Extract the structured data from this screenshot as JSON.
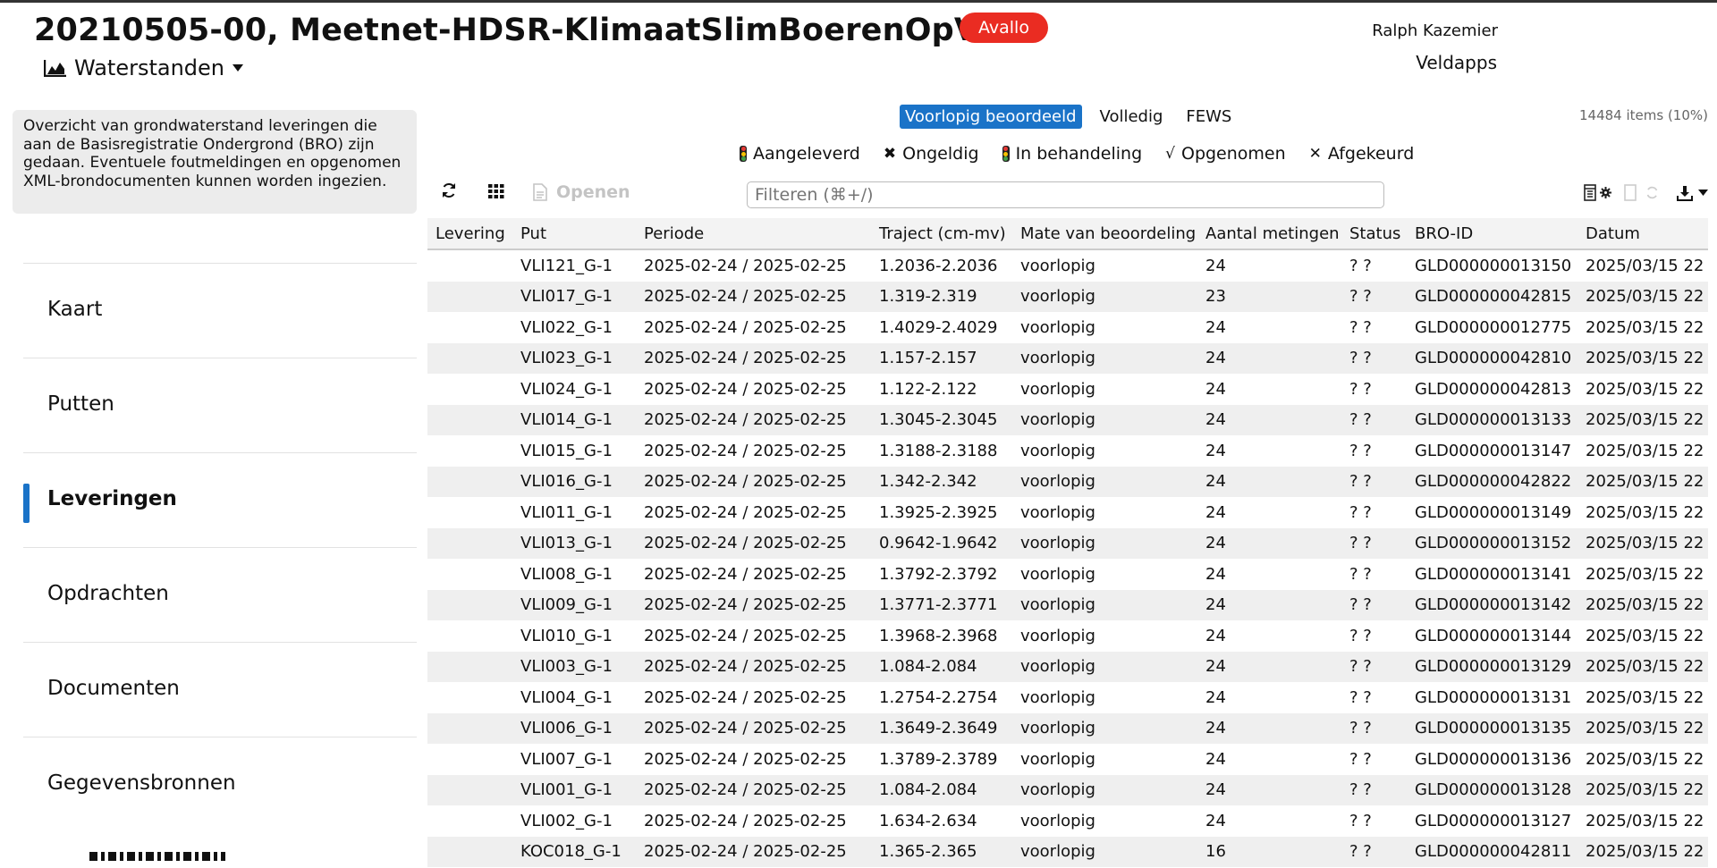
{
  "header": {
    "title": "20210505-00, Meetnet-HDSR-KlimaatSlimBoerenOpVeen",
    "badge": "Avallo",
    "view_label": "Waterstanden",
    "user": "Ralph Kazemier",
    "app_link": "Veldapps"
  },
  "sidebar": {
    "info": "Overzicht van grondwaterstand leveringen die aan de Basisregistratie Ondergrond (BRO) zijn gedaan. Eventuele foutmeldingen en opgenomen XML-brondocumenten kunnen worden ingezien.",
    "items": [
      {
        "label": "Kaart"
      },
      {
        "label": "Putten"
      },
      {
        "label": "Leveringen"
      },
      {
        "label": "Opdrachten"
      },
      {
        "label": "Documenten"
      },
      {
        "label": "Gegevensbronnen"
      }
    ]
  },
  "main": {
    "tabs": [
      {
        "label": "Voorlopig beoordeeld"
      },
      {
        "label": "Volledig"
      },
      {
        "label": "FEWS"
      }
    ],
    "item_count": "14484 items (10%)",
    "filters": [
      {
        "label": "Aangeleverd"
      },
      {
        "label": "Ongeldig"
      },
      {
        "label": "In behandeling"
      },
      {
        "label": "Opgenomen"
      },
      {
        "label": "Afgekeurd"
      }
    ],
    "open_label": "Openen",
    "search_placeholder": "Filteren (⌘+/)"
  },
  "colors": {
    "accent": "#1a73c8",
    "badge": "#ea2c22",
    "traffic_red": "#e53935",
    "traffic_yellow": "#f6c200",
    "traffic_green": "#43a047"
  },
  "icons": {
    "view": "area-chart-icon",
    "refresh": "refresh-icon",
    "grid": "grid-icon",
    "open": "document-icon",
    "export": "download-icon"
  },
  "table": {
    "columns": [
      "Levering",
      "Put",
      "Periode",
      "Traject (cm-mv)",
      "Mate van beoordeling",
      "Aantal metingen",
      "Status",
      "BRO-ID",
      "Datum"
    ],
    "rows": [
      [
        "",
        "VLI121_G-1",
        "2025-02-24 / 2025-02-25",
        "1.2036-2.2036",
        "voorlopig",
        "24",
        "? ?",
        "GLD000000013150",
        "2025/03/15 22"
      ],
      [
        "",
        "VLI017_G-1",
        "2025-02-24 / 2025-02-25",
        "1.319-2.319",
        "voorlopig",
        "23",
        "? ?",
        "GLD000000042815",
        "2025/03/15 22"
      ],
      [
        "",
        "VLI022_G-1",
        "2025-02-24 / 2025-02-25",
        "1.4029-2.4029",
        "voorlopig",
        "24",
        "? ?",
        "GLD000000012775",
        "2025/03/15 22"
      ],
      [
        "",
        "VLI023_G-1",
        "2025-02-24 / 2025-02-25",
        "1.157-2.157",
        "voorlopig",
        "24",
        "? ?",
        "GLD000000042810",
        "2025/03/15 22"
      ],
      [
        "",
        "VLI024_G-1",
        "2025-02-24 / 2025-02-25",
        "1.122-2.122",
        "voorlopig",
        "24",
        "? ?",
        "GLD000000042813",
        "2025/03/15 22"
      ],
      [
        "",
        "VLI014_G-1",
        "2025-02-24 / 2025-02-25",
        "1.3045-2.3045",
        "voorlopig",
        "24",
        "? ?",
        "GLD000000013133",
        "2025/03/15 22"
      ],
      [
        "",
        "VLI015_G-1",
        "2025-02-24 / 2025-02-25",
        "1.3188-2.3188",
        "voorlopig",
        "24",
        "? ?",
        "GLD000000013147",
        "2025/03/15 22"
      ],
      [
        "",
        "VLI016_G-1",
        "2025-02-24 / 2025-02-25",
        "1.342-2.342",
        "voorlopig",
        "24",
        "? ?",
        "GLD000000042822",
        "2025/03/15 22"
      ],
      [
        "",
        "VLI011_G-1",
        "2025-02-24 / 2025-02-25",
        "1.3925-2.3925",
        "voorlopig",
        "24",
        "? ?",
        "GLD000000013149",
        "2025/03/15 22"
      ],
      [
        "",
        "VLI013_G-1",
        "2025-02-24 / 2025-02-25",
        "0.9642-1.9642",
        "voorlopig",
        "24",
        "? ?",
        "GLD000000013152",
        "2025/03/15 22"
      ],
      [
        "",
        "VLI008_G-1",
        "2025-02-24 / 2025-02-25",
        "1.3792-2.3792",
        "voorlopig",
        "24",
        "? ?",
        "GLD000000013141",
        "2025/03/15 22"
      ],
      [
        "",
        "VLI009_G-1",
        "2025-02-24 / 2025-02-25",
        "1.3771-2.3771",
        "voorlopig",
        "24",
        "? ?",
        "GLD000000013142",
        "2025/03/15 22"
      ],
      [
        "",
        "VLI010_G-1",
        "2025-02-24 / 2025-02-25",
        "1.3968-2.3968",
        "voorlopig",
        "24",
        "? ?",
        "GLD000000013144",
        "2025/03/15 22"
      ],
      [
        "",
        "VLI003_G-1",
        "2025-02-24 / 2025-02-25",
        "1.084-2.084",
        "voorlopig",
        "24",
        "? ?",
        "GLD000000013129",
        "2025/03/15 22"
      ],
      [
        "",
        "VLI004_G-1",
        "2025-02-24 / 2025-02-25",
        "1.2754-2.2754",
        "voorlopig",
        "24",
        "? ?",
        "GLD000000013131",
        "2025/03/15 22"
      ],
      [
        "",
        "VLI006_G-1",
        "2025-02-24 / 2025-02-25",
        "1.3649-2.3649",
        "voorlopig",
        "24",
        "? ?",
        "GLD000000013135",
        "2025/03/15 22"
      ],
      [
        "",
        "VLI007_G-1",
        "2025-02-24 / 2025-02-25",
        "1.3789-2.3789",
        "voorlopig",
        "24",
        "? ?",
        "GLD000000013136",
        "2025/03/15 22"
      ],
      [
        "",
        "VLI001_G-1",
        "2025-02-24 / 2025-02-25",
        "1.084-2.084",
        "voorlopig",
        "24",
        "? ?",
        "GLD000000013128",
        "2025/03/15 22"
      ],
      [
        "",
        "VLI002_G-1",
        "2025-02-24 / 2025-02-25",
        "1.634-2.634",
        "voorlopig",
        "24",
        "? ?",
        "GLD000000013127",
        "2025/03/15 22"
      ],
      [
        "",
        "KOC018_G-1",
        "2025-02-24 / 2025-02-25",
        "1.365-2.365",
        "voorlopig",
        "16",
        "? ?",
        "GLD000000042811",
        "2025/03/15 22"
      ]
    ]
  }
}
